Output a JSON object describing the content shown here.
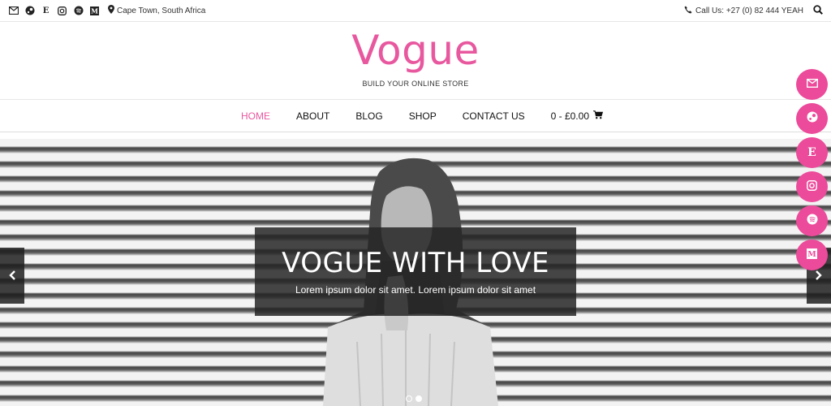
{
  "topbar": {
    "social_icons": [
      "envelope-icon",
      "steam-icon",
      "etsy-icon",
      "instagram-icon",
      "spotify-icon",
      "medium-icon"
    ],
    "location": "Cape Town, South Africa",
    "phone": "Call Us: +27 (0) 82 444 YEAH"
  },
  "header": {
    "logo": "Vogue",
    "tagline": "BUILD YOUR ONLINE STORE"
  },
  "nav": {
    "items": [
      "HOME",
      "ABOUT",
      "BLOG",
      "SHOP",
      "CONTACT US"
    ],
    "active": "HOME",
    "cart": "0 - £0.00"
  },
  "slider": {
    "title": "VOGUE WITH LOVE",
    "subtitle": "Lorem ipsum dolor sit amet. Lorem ipsum dolor sit amet",
    "slide_count": 2,
    "active_slide": 2
  },
  "colors": {
    "accent": "#e8589f",
    "float_button": "#ec4a9a",
    "caption_bg": "#262626"
  }
}
